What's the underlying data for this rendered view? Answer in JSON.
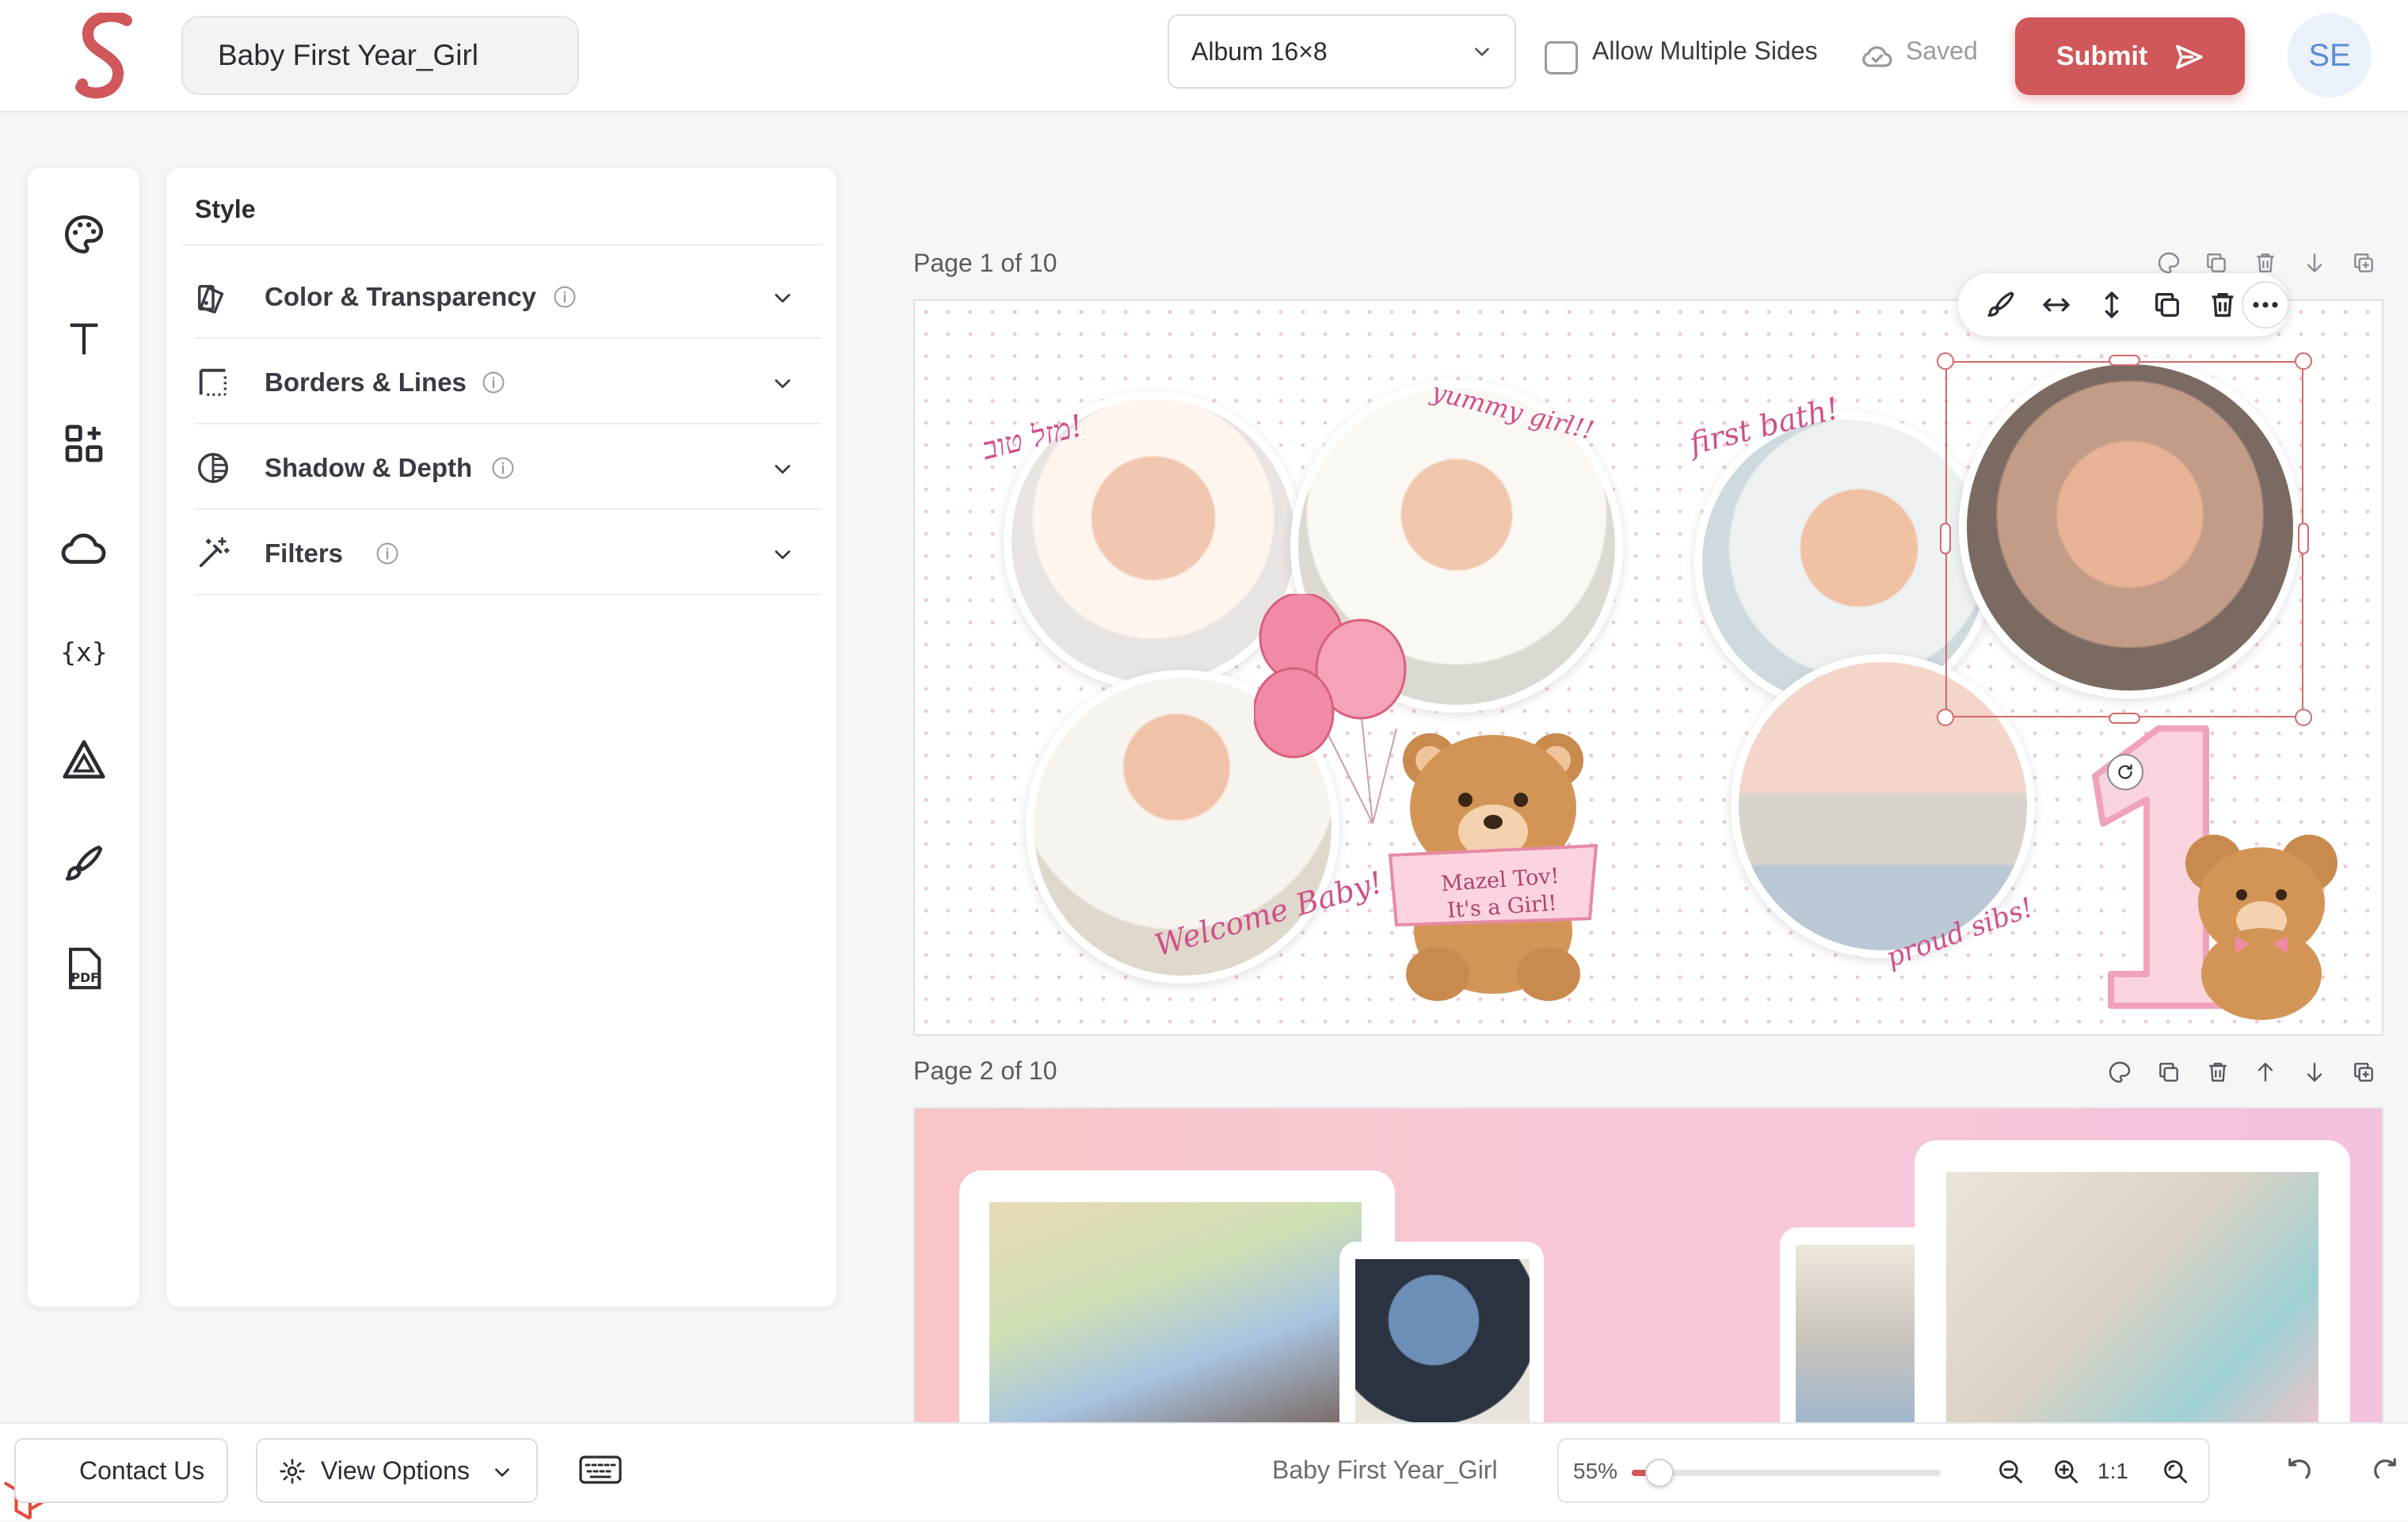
{
  "header": {
    "document_title": "Baby First Year_Girl",
    "album_format": "Album 16×8",
    "allow_multiple_sides_label": "Allow Multiple Sides",
    "allow_multiple_sides_checked": false,
    "saved_label": "Saved",
    "submit_label": "Submit",
    "avatar_initials": "SE"
  },
  "rail": {
    "items": [
      {
        "icon": "palette-icon"
      },
      {
        "icon": "text-icon"
      },
      {
        "icon": "elements-icon"
      },
      {
        "icon": "cloud-icon"
      },
      {
        "icon": "variables-icon"
      },
      {
        "icon": "shapes-icon"
      },
      {
        "icon": "brush-icon"
      },
      {
        "icon": "pdf-icon"
      }
    ]
  },
  "style_panel": {
    "title": "Style",
    "sections": [
      {
        "label": "Color & Transparency",
        "icon": "color-transparency-icon"
      },
      {
        "label": "Borders & Lines",
        "icon": "borders-icon"
      },
      {
        "label": "Shadow & Depth",
        "icon": "shadow-icon"
      },
      {
        "label": "Filters",
        "icon": "magic-wand-icon"
      }
    ]
  },
  "canvas": {
    "page1_label": "Page 1 of 10",
    "page2_label": "Page 2 of 10",
    "page1": {
      "captions": {
        "hebrew": "מזל טוב!",
        "yummy": "yummy girl!!",
        "first_bath": "first bath!",
        "welcome": "Welcome Baby!",
        "proud_sibs": "proud sibs!"
      },
      "banner_line1": "Mazel Tov!",
      "banner_line2": "It's a Girl!",
      "big_number": "1"
    }
  },
  "footer": {
    "contact_label": "Contact Us",
    "view_options_label": "View Options",
    "document_title": "Baby First Year_Girl",
    "zoom_percent": "55%",
    "zoom_level": 0.055,
    "zoom_reset_label": "1:1"
  },
  "colors": {
    "accent": "#d0575a",
    "script_pink": "#d0508a",
    "avatar_bg": "#eaf1fb"
  }
}
